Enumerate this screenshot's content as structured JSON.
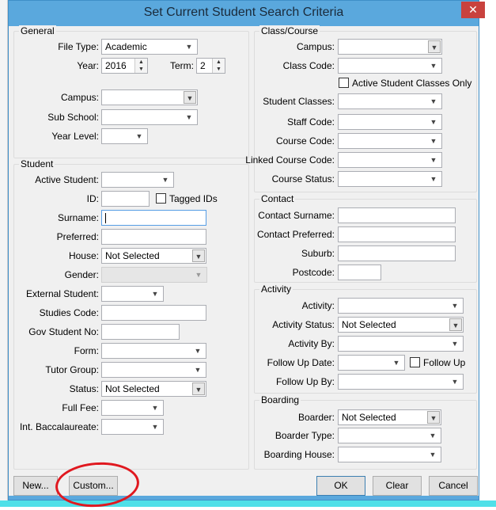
{
  "window": {
    "title": "Set Current Student Search Criteria",
    "close": "✕"
  },
  "groups": {
    "general": "General",
    "student": "Student",
    "class_course": "Class/Course",
    "contact": "Contact",
    "activity": "Activity",
    "boarding": "Boarding"
  },
  "fields": {
    "file_type": {
      "label": "File Type:",
      "value": "Academic"
    },
    "year": {
      "label": "Year:",
      "value": "2016"
    },
    "term": {
      "label": "Term:",
      "value": "2"
    },
    "g_campus": {
      "label": "Campus:",
      "value": ""
    },
    "sub_school": {
      "label": "Sub School:",
      "value": ""
    },
    "year_level": {
      "label": "Year Level:",
      "value": ""
    },
    "active_student": {
      "label": "Active Student:",
      "value": ""
    },
    "id": {
      "label": "ID:",
      "value": ""
    },
    "surname": {
      "label": "Surname:",
      "value": ""
    },
    "preferred": {
      "label": "Preferred:",
      "value": ""
    },
    "house": {
      "label": "House:",
      "value": "Not Selected"
    },
    "gender": {
      "label": "Gender:",
      "value": ""
    },
    "external_student": {
      "label": "External Student:",
      "value": ""
    },
    "studies_code": {
      "label": "Studies Code:",
      "value": ""
    },
    "gov_student_no": {
      "label": "Gov Student No:",
      "value": ""
    },
    "form": {
      "label": "Form:",
      "value": ""
    },
    "tutor_group": {
      "label": "Tutor Group:",
      "value": ""
    },
    "status": {
      "label": "Status:",
      "value": "Not Selected"
    },
    "full_fee": {
      "label": "Full Fee:",
      "value": ""
    },
    "int_bacc": {
      "label": "Int. Baccalaureate:",
      "value": ""
    },
    "c_campus": {
      "label": "Campus:",
      "value": ""
    },
    "class_code": {
      "label": "Class Code:",
      "value": ""
    },
    "student_classes": {
      "label": "Student Classes:",
      "value": ""
    },
    "staff_code": {
      "label": "Staff Code:",
      "value": ""
    },
    "course_code": {
      "label": "Course Code:",
      "value": ""
    },
    "linked_course_code": {
      "label": "Linked Course Code:",
      "value": ""
    },
    "course_status": {
      "label": "Course Status:",
      "value": ""
    },
    "contact_surname": {
      "label": "Contact Surname:",
      "value": ""
    },
    "contact_preferred": {
      "label": "Contact Preferred:",
      "value": ""
    },
    "suburb": {
      "label": "Suburb:",
      "value": ""
    },
    "postcode": {
      "label": "Postcode:",
      "value": ""
    },
    "activity": {
      "label": "Activity:",
      "value": ""
    },
    "activity_status": {
      "label": "Activity Status:",
      "value": "Not Selected"
    },
    "activity_by": {
      "label": "Activity By:",
      "value": ""
    },
    "follow_up_date": {
      "label": "Follow Up Date:",
      "value": ""
    },
    "follow_up_by": {
      "label": "Follow Up By:",
      "value": ""
    },
    "boarder": {
      "label": "Boarder:",
      "value": "Not Selected"
    },
    "boarder_type": {
      "label": "Boarder Type:",
      "value": ""
    },
    "boarding_house": {
      "label": "Boarding House:",
      "value": ""
    }
  },
  "checkboxes": {
    "tagged_ids": {
      "label": "Tagged IDs",
      "checked": false
    },
    "active_classes_only": {
      "label": "Active Student Classes Only",
      "checked": false
    },
    "follow_up": {
      "label": "Follow Up",
      "checked": false
    }
  },
  "buttons": {
    "new": "New...",
    "custom": "Custom...",
    "ok": "OK",
    "clear": "Clear",
    "cancel": "Cancel"
  }
}
